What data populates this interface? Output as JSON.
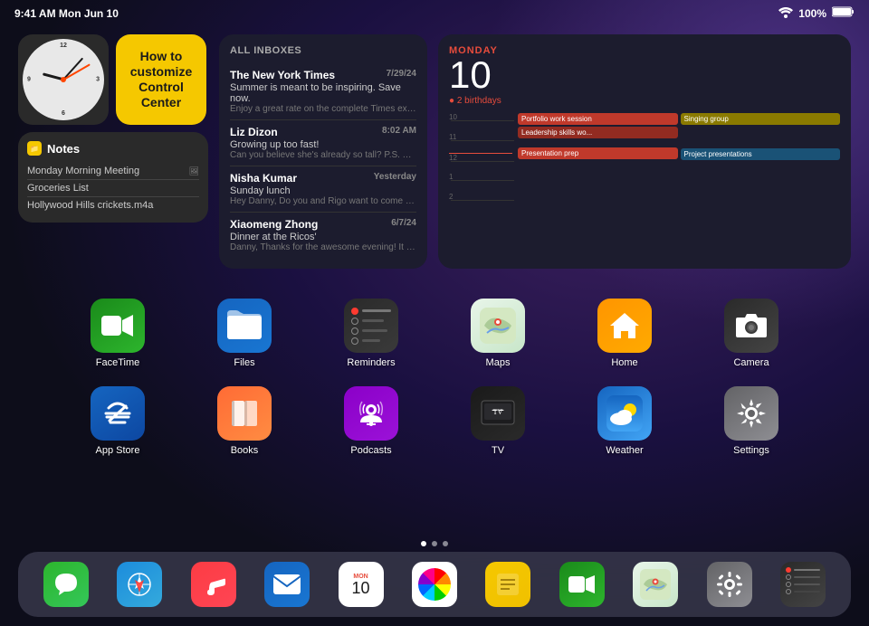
{
  "status_bar": {
    "time": "9:41 AM  Mon Jun 10",
    "wifi": "WiFi",
    "battery": "100%"
  },
  "widgets": {
    "clock": {
      "label": "Clock"
    },
    "control_center": {
      "text": "How to customize Control Center"
    },
    "notes": {
      "title": "Notes",
      "items": [
        {
          "text": "Monday Morning Meeting",
          "has_icon": true
        },
        {
          "text": "Groceries List",
          "has_icon": false
        },
        {
          "text": "Hollywood Hills crickets.m4a",
          "has_icon": false
        }
      ]
    },
    "mail": {
      "header": "All Inboxes",
      "emails": [
        {
          "sender": "The New York Times",
          "date": "7/29/24",
          "subject": "Summer is meant to be inspiring. Save now.",
          "preview": "Enjoy a great rate on the complete Times experie..."
        },
        {
          "sender": "Liz Dizon",
          "date": "8:02 AM",
          "subject": "Growing up too fast!",
          "preview": "Can you believe she's already so tall? P.S. Thanks..."
        },
        {
          "sender": "Nisha Kumar",
          "date": "Yesterday",
          "subject": "Sunday lunch",
          "preview": "Hey Danny, Do you and Rigo want to come to lun..."
        },
        {
          "sender": "Xiaomeng Zhong",
          "date": "6/7/24",
          "subject": "Dinner at the Ricos'",
          "preview": "Danny, Thanks for the awesome evening! It was s..."
        }
      ]
    },
    "calendar": {
      "day": "MONDAY",
      "date": "10",
      "birthdays": "2 birthdays",
      "events": [
        {
          "title": "Portfolio work session",
          "color": "red",
          "col": 1
        },
        {
          "title": "Singing group",
          "color": "yellow",
          "col": 2
        },
        {
          "title": "Leadership skills wo...",
          "color": "dark-red",
          "col": 1
        },
        {
          "title": "Project presentations",
          "color": "blue",
          "col": 2
        },
        {
          "title": "Presentation prep",
          "color": "red",
          "col": 1
        }
      ]
    }
  },
  "apps_row1": [
    {
      "name": "FaceTime",
      "icon_class": "icon-facetime",
      "icon": "📹"
    },
    {
      "name": "Files",
      "icon_class": "icon-files",
      "icon": "🗂"
    },
    {
      "name": "Reminders",
      "icon_class": "icon-reminders",
      "icon": ""
    },
    {
      "name": "Maps",
      "icon_class": "icon-maps",
      "icon": ""
    },
    {
      "name": "Home",
      "icon_class": "icon-home",
      "icon": "🏠"
    },
    {
      "name": "Camera",
      "icon_class": "icon-camera",
      "icon": "📷"
    }
  ],
  "apps_row2": [
    {
      "name": "App Store",
      "icon_class": "icon-appstore",
      "icon": "🅰"
    },
    {
      "name": "Books",
      "icon_class": "icon-books",
      "icon": "📚"
    },
    {
      "name": "Podcasts",
      "icon_class": "icon-podcasts",
      "icon": "🎙"
    },
    {
      "name": "TV",
      "icon_class": "icon-tv",
      "icon": ""
    },
    {
      "name": "Weather",
      "icon_class": "icon-weather",
      "icon": "🌤"
    },
    {
      "name": "Settings",
      "icon_class": "icon-settings",
      "icon": "⚙️"
    }
  ],
  "page_dots": [
    true,
    false,
    false
  ],
  "dock": {
    "items": [
      {
        "name": "Messages",
        "class": "messages",
        "icon": "💬"
      },
      {
        "name": "Safari",
        "class": "safari",
        "icon": "🧭"
      },
      {
        "name": "Music",
        "class": "music",
        "icon": "🎵"
      },
      {
        "name": "Mail",
        "class": "mail",
        "icon": "✉️"
      },
      {
        "name": "Calendar",
        "class": "calendar",
        "month": "MON",
        "day": "10"
      },
      {
        "name": "Photos",
        "class": "photos",
        "icon": "photos"
      },
      {
        "name": "Notes",
        "class": "notes-dock",
        "icon": "📝"
      },
      {
        "name": "FaceTime",
        "class": "facetime-dock",
        "icon": "📹"
      },
      {
        "name": "Maps",
        "class": "maps-dock",
        "icon": "🗺"
      },
      {
        "name": "Settings",
        "class": "settings-dock",
        "icon": "⚙️"
      },
      {
        "name": "Reminders",
        "class": "reminders-dock",
        "icon": "rem"
      }
    ]
  }
}
